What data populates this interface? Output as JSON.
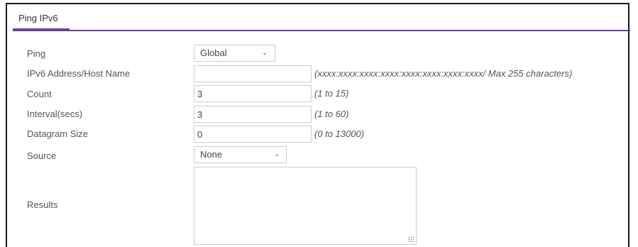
{
  "panel": {
    "tab_title": "Ping IPv6"
  },
  "form": {
    "ping": {
      "label": "Ping",
      "selected": "Global"
    },
    "address": {
      "label": "IPv6 Address/Host Name",
      "value": "",
      "hint": "(xxxx:xxxx:xxxx:xxxx:xxxx:xxxx:xxxx:xxxx/ Max 255 characters)"
    },
    "count": {
      "label": "Count",
      "value": "3",
      "hint": "(1 to 15)"
    },
    "interval": {
      "label": "Interval(secs)",
      "value": "3",
      "hint": "(1 to 60)"
    },
    "datagram_size": {
      "label": "Datagram Size",
      "value": "0",
      "hint": "(0 to 13000)"
    },
    "source": {
      "label": "Source",
      "selected": "None"
    },
    "results": {
      "label": "Results",
      "value": ""
    }
  },
  "colors": {
    "accent": "#6b3fa0",
    "frame": "#1a1a1a",
    "field_border": "#cccccc"
  }
}
